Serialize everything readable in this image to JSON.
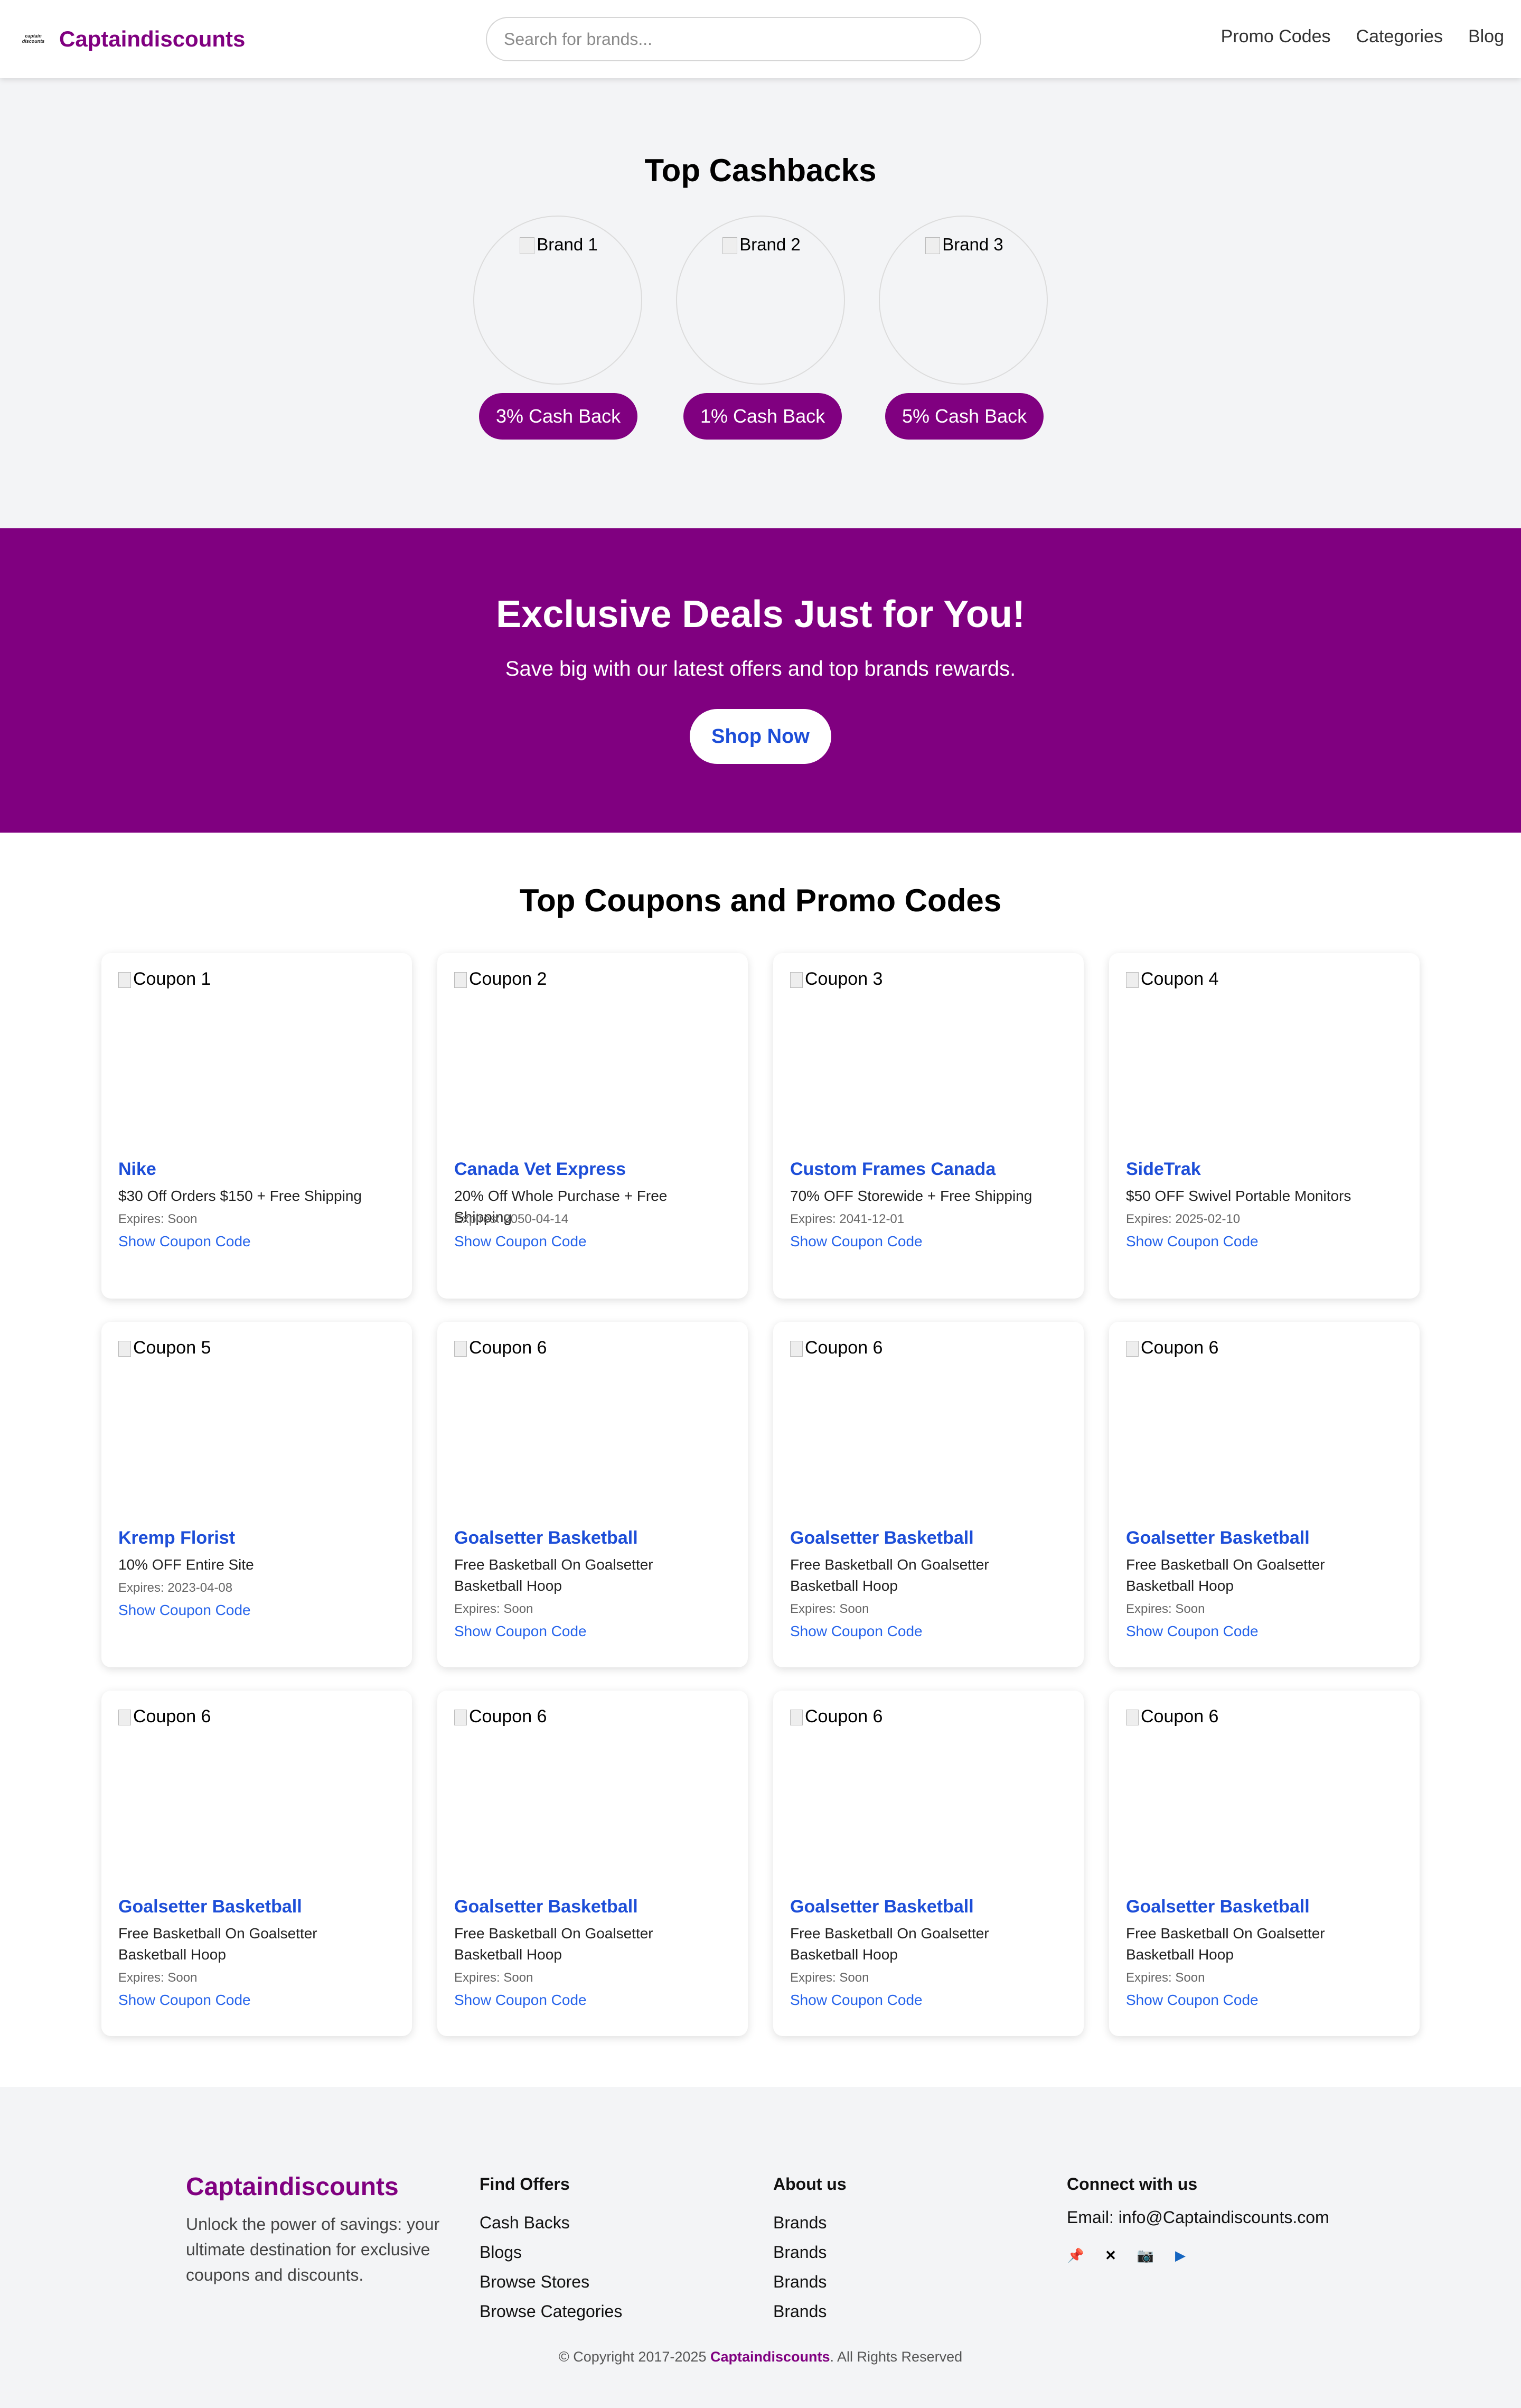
{
  "header": {
    "logo_mark": "captain discounts",
    "logo_text": "Captaindiscounts",
    "search_placeholder": "Search for brands...",
    "nav": [
      "Promo Codes",
      "Categories",
      "Blog"
    ]
  },
  "cashbacks": {
    "title": "Top Cashbacks",
    "brands": [
      {
        "alt": "Brand 1",
        "label": "3% Cash Back"
      },
      {
        "alt": "Brand 2",
        "label": "1% Cash Back"
      },
      {
        "alt": "Brand 3",
        "label": "5% Cash Back"
      }
    ]
  },
  "deals": {
    "title": "Exclusive Deals Just for You!",
    "subtitle": "Save big with our latest offers and top brands rewards.",
    "button": "Shop Now"
  },
  "coupons": {
    "title": "Top Coupons and Promo Codes",
    "items": [
      {
        "alt": "Coupon 1",
        "brand": "Nike",
        "desc": "$30 Off Orders $150 + Free Shipping",
        "expires": "Expires: Soon",
        "link": "Show Coupon Code"
      },
      {
        "alt": "Coupon 2",
        "brand": "Canada Vet Express",
        "desc": "20% Off Whole Purchase + Free Shipping",
        "expires": "Expires: 2050-04-14",
        "link": "Show Coupon Code"
      },
      {
        "alt": "Coupon 3",
        "brand": "Custom Frames Canada",
        "desc": "70% OFF Storewide + Free Shipping",
        "expires": "Expires: 2041-12-01",
        "link": "Show Coupon Code"
      },
      {
        "alt": "Coupon 4",
        "brand": "SideTrak",
        "desc": "$50 OFF Swivel Portable Monitors",
        "expires": "Expires: 2025-02-10",
        "link": "Show Coupon Code"
      },
      {
        "alt": "Coupon 5",
        "brand": "Kremp Florist",
        "desc": "10% OFF Entire Site",
        "expires": "Expires: 2023-04-08",
        "link": "Show Coupon Code"
      },
      {
        "alt": "Coupon 6",
        "brand": "Goalsetter Basketball",
        "desc": "Free Basketball On Goalsetter Basketball Hoop",
        "expires": "Expires: Soon",
        "link": "Show Coupon Code"
      },
      {
        "alt": "Coupon 6",
        "brand": "Goalsetter Basketball",
        "desc": "Free Basketball On Goalsetter Basketball Hoop",
        "expires": "Expires: Soon",
        "link": "Show Coupon Code"
      },
      {
        "alt": "Coupon 6",
        "brand": "Goalsetter Basketball",
        "desc": "Free Basketball On Goalsetter Basketball Hoop",
        "expires": "Expires: Soon",
        "link": "Show Coupon Code"
      },
      {
        "alt": "Coupon 6",
        "brand": "Goalsetter Basketball",
        "desc": "Free Basketball On Goalsetter Basketball Hoop",
        "expires": "Expires: Soon",
        "link": "Show Coupon Code"
      },
      {
        "alt": "Coupon 6",
        "brand": "Goalsetter Basketball",
        "desc": "Free Basketball On Goalsetter Basketball Hoop",
        "expires": "Expires: Soon",
        "link": "Show Coupon Code"
      },
      {
        "alt": "Coupon 6",
        "brand": "Goalsetter Basketball",
        "desc": "Free Basketball On Goalsetter Basketball Hoop",
        "expires": "Expires: Soon",
        "link": "Show Coupon Code"
      },
      {
        "alt": "Coupon 6",
        "brand": "Goalsetter Basketball",
        "desc": "Free Basketball On Goalsetter Basketball Hoop",
        "expires": "Expires: Soon",
        "link": "Show Coupon Code"
      }
    ]
  },
  "footer": {
    "brand": "Captaindiscounts",
    "tagline": "Unlock the power of savings: your ultimate destination for exclusive coupons and discounts.",
    "find_offers": {
      "title": "Find Offers",
      "links": [
        "Cash Backs",
        "Blogs",
        "Browse Stores",
        "Browse Categories"
      ]
    },
    "about": {
      "title": "About us",
      "links": [
        "Brands",
        "Brands",
        "Brands",
        "Brands"
      ]
    },
    "connect": {
      "title": "Connect with us",
      "email": "Email: info@Captaindiscounts.com",
      "socials": [
        "pin-icon",
        "x-icon",
        "camera-icon",
        "play-icon"
      ]
    },
    "copyright_prefix": "© Copyright 2017-2025 ",
    "copyright_brand": "Captaindiscounts",
    "copyright_suffix": ". All Rights Reserved"
  },
  "colors": {
    "brand": "#800080",
    "link": "#1d4ed8",
    "bg_gray": "#f3f4f6"
  }
}
